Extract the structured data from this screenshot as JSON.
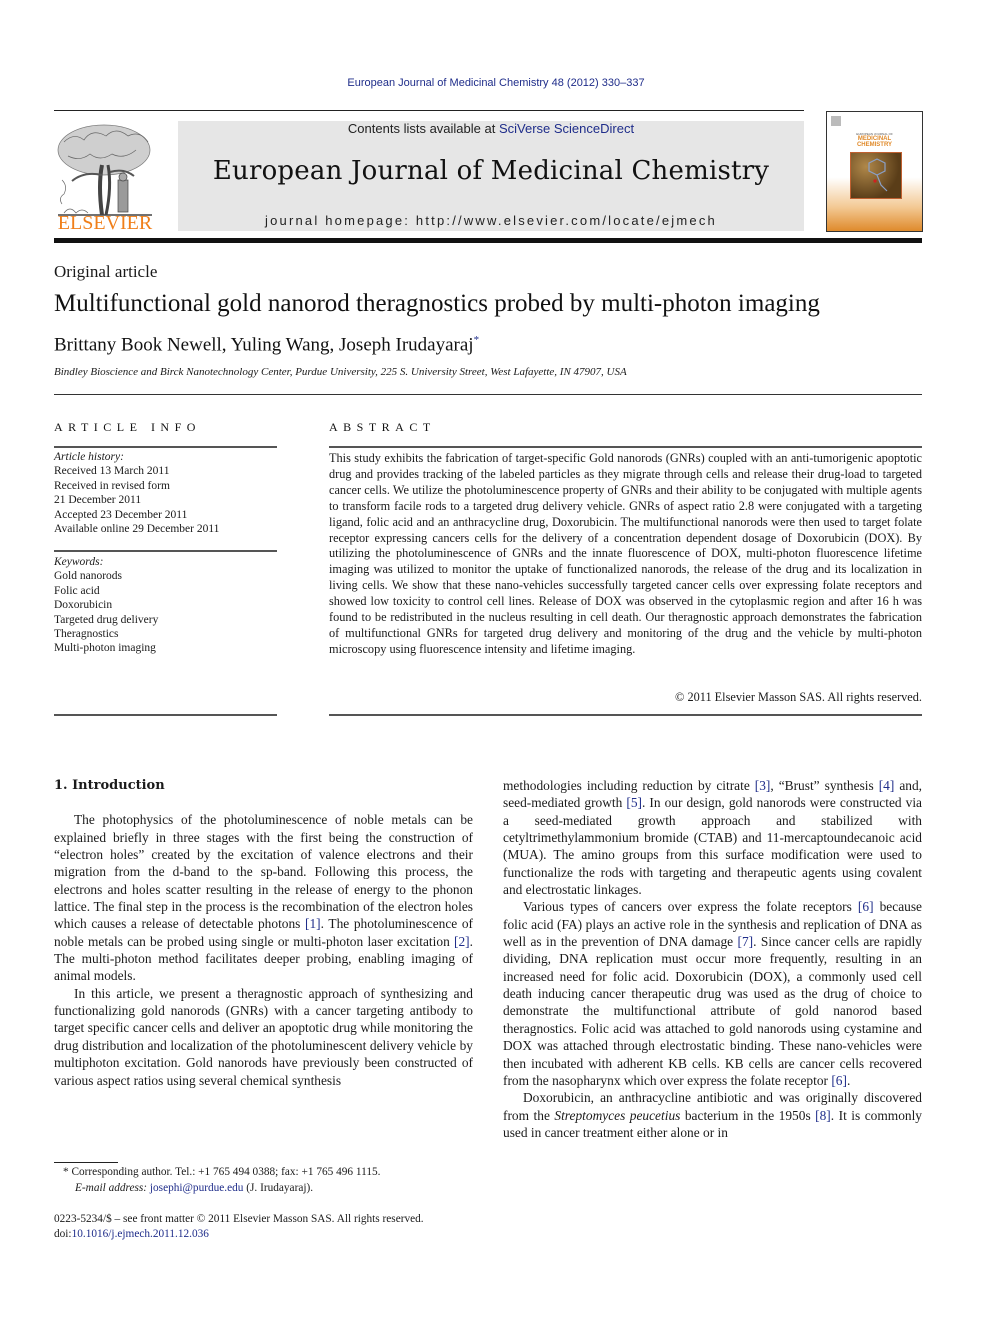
{
  "header": {
    "citation": "European Journal of Medicinal Chemistry 48 (2012) 330–337",
    "contents_prefix": "Contents lists available at ",
    "contents_link": "SciVerse ScienceDirect",
    "journal_title": "European Journal of Medicinal Chemistry",
    "homepage": "journal homepage: http://www.elsevier.com/locate/ejmech",
    "publisher_logo_text": "ELSEVIER",
    "cover": {
      "line1": "EUROPEAN JOURNAL OF",
      "line2": "MEDICINAL",
      "line3": "CHEMISTRY"
    }
  },
  "colors": {
    "link": "#1f2d8a",
    "elsevier_orange": "#f07f1a",
    "banner_bg": "#e6e6e6"
  },
  "article": {
    "type": "Original article",
    "title": "Multifunctional gold nanorod theragnostics probed by multi-photon imaging",
    "authors": "Brittany Book Newell, Yuling Wang, Joseph Irudayaraj",
    "corresponding_mark": "*",
    "affiliation": "Bindley Bioscience and Birck Nanotechnology Center, Purdue University, 225 S. University Street, West Lafayette, IN 47907, USA"
  },
  "article_info": {
    "heading": "ARTICLE INFO",
    "history_label": "Article history:",
    "history": [
      "Received 13 March 2011",
      "Received in revised form",
      "21 December 2011",
      "Accepted 23 December 2011",
      "Available online 29 December 2011"
    ],
    "keywords_label": "Keywords:",
    "keywords": [
      "Gold nanorods",
      "Folic acid",
      "Doxorubicin",
      "Targeted drug delivery",
      "Theragnostics",
      "Multi-photon imaging"
    ]
  },
  "abstract": {
    "heading": "ABSTRACT",
    "text": "This study exhibits the fabrication of target-specific Gold nanorods (GNRs) coupled with an anti-tumorigenic apoptotic drug and provides tracking of the labeled particles as they migrate through cells and release their drug-load to targeted cancer cells. We utilize the photoluminescence property of GNRs and their ability to be conjugated with multiple agents to transform facile rods to a targeted drug delivery vehicle. GNRs of aspect ratio 2.8 were conjugated with a targeting ligand, folic acid and an anthracycline drug, Doxorubicin. The multifunctional nanorods were then used to target folate receptor expressing cancers cells for the delivery of a concentration dependent dosage of Doxorubicin (DOX). By utilizing the photoluminescence of GNRs and the innate fluorescence of DOX, multi-photon fluorescence lifetime imaging was utilized to monitor the uptake of functionalized nanorods, the release of the drug and its localization in living cells. We show that these nano-vehicles successfully targeted cancer cells over expressing folate receptors and showed low toxicity to control cell lines. Release of DOX was observed in the cytoplasmic region and after 16 h was found to be redistributed in the nucleus resulting in cell death. Our theragnostic approach demonstrates the fabrication of multifunctional GNRs for tar­geted drug delivery and monitoring of the drug and the vehicle by multi-photon microscopy using fluorescence intensity and lifetime imaging.",
    "copyright": "© 2011 Elsevier Masson SAS. All rights reserved."
  },
  "body": {
    "section_heading": "1.  Introduction",
    "left": {
      "p1": [
        {
          "t": "The photophysics of the photoluminescence of noble metals can be explained briefly in three stages with the first being the construction of “electron holes” created by the excitation of valence electrons and their migration from the d-band to the sp-band. Following this process, the electrons and holes scatter resulting in the release of energy to the phonon lattice. The final step in the process is the recombination of the electron holes which causes a release of detectable photons "
        },
        {
          "ref": "[1]"
        },
        {
          "t": ". The photoluminescence of noble metals can be probed using single or multi-photon laser excitation "
        },
        {
          "ref": "[2]"
        },
        {
          "t": ". The multi-photon method facilitates deeper probing, enabling imaging of animal models."
        }
      ],
      "p2": "In this article, we present a theragnostic approach of synthe­sizing and functionalizing gold nanorods (GNRs) with a cancer targeting antibody to target specific cancer cells and deliver an apoptotic drug while monitoring the drug distribution and localization of the photoluminescent delivery vehicle by multi­photon excitation. Gold nanorods have previously been con­structed of various aspect ratios using several chemical synthesis"
    },
    "right": {
      "p1": [
        {
          "t": "methodologies including reduction by citrate "
        },
        {
          "ref": "[3]"
        },
        {
          "t": ", “Brust” synthesis "
        },
        {
          "ref": "[4]"
        },
        {
          "t": " and, seed-mediated growth "
        },
        {
          "ref": "[5]"
        },
        {
          "t": ". In our design, gold nanorods were constructed via a seed-mediated growth approach and stabilized with cetyltrimethylammonium bromide (CTAB) and 11-mercaptoundecanoic acid (MUA). The amino groups from this surface modification were used to functionalize the rods with tar­geting and therapeutic agents using covalent and electrostatic linkages."
        }
      ],
      "p2": [
        {
          "t": "Various types of cancers over express the folate receptors "
        },
        {
          "ref": "[6]"
        },
        {
          "t": " because folic acid (FA) plays an active role in the synthesis and replication of DNA as well as in the prevention of DNA damage "
        },
        {
          "ref": "[7]"
        },
        {
          "t": ". Since cancer cells are rapidly dividing, DNA replication must occur more frequently, resulting in an increased need for folic acid. Doxorubicin (DOX), a commonly used cell death inducing cancer therapeutic drug was used as the drug of choice to demonstrate the multifunctional attribute of gold nanorod based theragnostics. Folic acid was attached to gold nanorods using cystamine and DOX was attached through electrostatic binding. These nano-vehicles were then incubated with adherent KB cells. KB cells are cancer cells recovered from the nasopharynx which over express the folate receptor "
        },
        {
          "ref": "[6]"
        },
        {
          "t": "."
        }
      ],
      "p3": [
        {
          "t": "Doxorubicin, an anthracycline antibiotic and was originally discovered from the "
        },
        {
          "i": "Streptomyces peucetius"
        },
        {
          "t": " bacterium in the 1950s "
        },
        {
          "ref": "[8]"
        },
        {
          "t": ". It is commonly used in cancer treatment either alone or in"
        }
      ]
    }
  },
  "footnotes": {
    "corresponding": "*  Corresponding author. Tel.: +1 765 494 0388; fax: +1 765 496 1115.",
    "email_label": "E-mail address: ",
    "email": "josephi@purdue.edu",
    "email_suffix": " (J. Irudayaraj).",
    "front_matter": "0223-5234/$ – see front matter © 2011 Elsevier Masson SAS. All rights reserved.",
    "doi_prefix": "doi:",
    "doi": "10.1016/j.ejmech.2011.12.036"
  }
}
